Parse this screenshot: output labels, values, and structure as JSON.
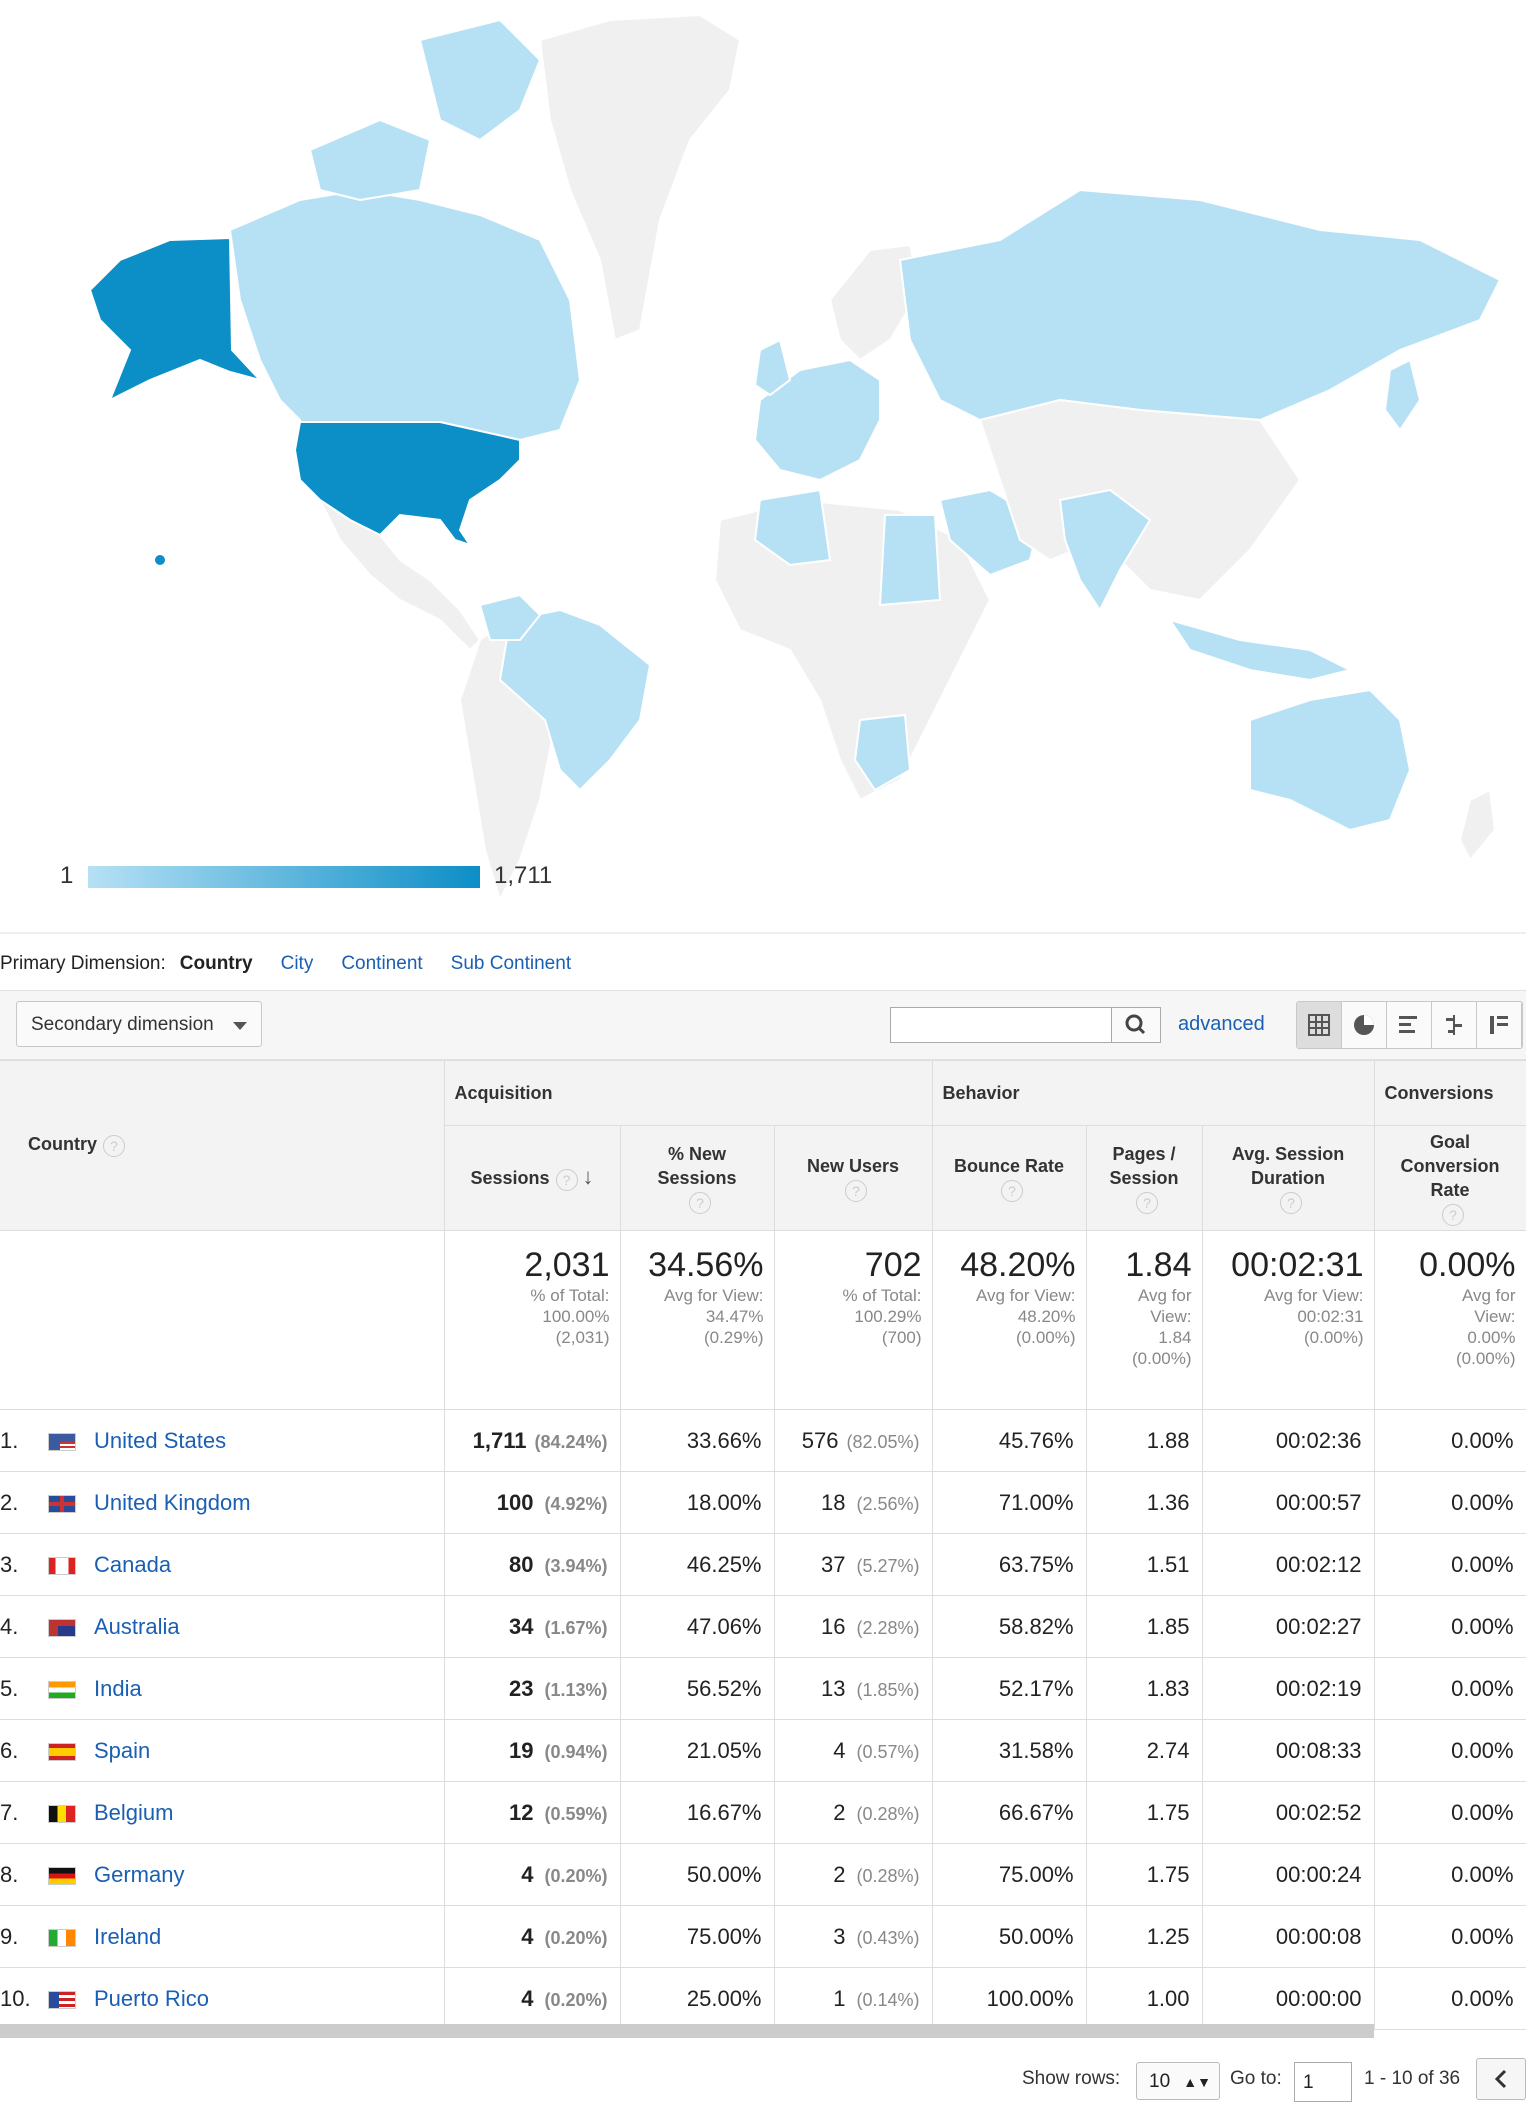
{
  "map": {
    "legend_min": "1",
    "legend_max": "1,711",
    "color_low": "#b6e1f5",
    "color_high": "#0c8ec6",
    "color_none": "#f0f0f0"
  },
  "primary_dimension": {
    "label": "Primary Dimension:",
    "current": "Country",
    "options": [
      "City",
      "Continent",
      "Sub Continent"
    ]
  },
  "toolbar": {
    "secondary_dimension": "Secondary dimension",
    "search_value": "",
    "advanced_label": "advanced"
  },
  "table": {
    "groups": {
      "acquisition": "Acquisition",
      "behavior": "Behavior",
      "conversions": "Conversions"
    },
    "columns": {
      "country": "Country",
      "sessions": "Sessions",
      "new_sessions": "% New Sessions",
      "new_users": "New Users",
      "bounce_rate": "Bounce Rate",
      "pages_session": "Pages / Session",
      "avg_duration": "Avg. Session Duration",
      "goal_rate": "Goal Conversion Rate"
    },
    "totals": {
      "sessions": {
        "value": "2,031",
        "sub1": "% of Total:",
        "sub2": "100.00%",
        "sub3": "(2,031)"
      },
      "new_sessions": {
        "value": "34.56%",
        "sub1": "Avg for View:",
        "sub2": "34.47%",
        "sub3": "(0.29%)"
      },
      "new_users": {
        "value": "702",
        "sub1": "% of Total:",
        "sub2": "100.29%",
        "sub3": "(700)"
      },
      "bounce_rate": {
        "value": "48.20%",
        "sub1": "Avg for View:",
        "sub2": "48.20%",
        "sub3": "(0.00%)"
      },
      "pages_session": {
        "value": "1.84",
        "sub1": "Avg for",
        "sub2": "View:",
        "sub3": "1.84",
        "sub4": "(0.00%)"
      },
      "avg_duration": {
        "value": "00:02:31",
        "sub1": "Avg for View:",
        "sub2": "00:02:31",
        "sub3": "(0.00%)"
      },
      "goal_rate": {
        "value": "0.00%",
        "sub1": "Avg for",
        "sub2": "View:",
        "sub3": "0.00%",
        "sub4": "(0.00%)"
      }
    },
    "rows": [
      {
        "n": "1.",
        "country": "United States",
        "flag": "us-flag",
        "sessions": "1,711",
        "sessions_pct": "(84.24%)",
        "new_sessions": "33.66%",
        "new_users": "576",
        "new_users_pct": "(82.05%)",
        "bounce": "45.76%",
        "pages": "1.88",
        "duration": "00:02:36",
        "goal": "0.00%"
      },
      {
        "n": "2.",
        "country": "United Kingdom",
        "flag": "uk-flag",
        "sessions": "100",
        "sessions_pct": "(4.92%)",
        "new_sessions": "18.00%",
        "new_users": "18",
        "new_users_pct": "(2.56%)",
        "bounce": "71.00%",
        "pages": "1.36",
        "duration": "00:00:57",
        "goal": "0.00%"
      },
      {
        "n": "3.",
        "country": "Canada",
        "flag": "canada-flag",
        "sessions": "80",
        "sessions_pct": "(3.94%)",
        "new_sessions": "46.25%",
        "new_users": "37",
        "new_users_pct": "(5.27%)",
        "bounce": "63.75%",
        "pages": "1.51",
        "duration": "00:02:12",
        "goal": "0.00%"
      },
      {
        "n": "4.",
        "country": "Australia",
        "flag": "australia-flag",
        "sessions": "34",
        "sessions_pct": "(1.67%)",
        "new_sessions": "47.06%",
        "new_users": "16",
        "new_users_pct": "(2.28%)",
        "bounce": "58.82%",
        "pages": "1.85",
        "duration": "00:02:27",
        "goal": "0.00%"
      },
      {
        "n": "5.",
        "country": "India",
        "flag": "india-flag",
        "sessions": "23",
        "sessions_pct": "(1.13%)",
        "new_sessions": "56.52%",
        "new_users": "13",
        "new_users_pct": "(1.85%)",
        "bounce": "52.17%",
        "pages": "1.83",
        "duration": "00:02:19",
        "goal": "0.00%"
      },
      {
        "n": "6.",
        "country": "Spain",
        "flag": "spain-flag",
        "sessions": "19",
        "sessions_pct": "(0.94%)",
        "new_sessions": "21.05%",
        "new_users": "4",
        "new_users_pct": "(0.57%)",
        "bounce": "31.58%",
        "pages": "2.74",
        "duration": "00:08:33",
        "goal": "0.00%"
      },
      {
        "n": "7.",
        "country": "Belgium",
        "flag": "belgium-flag",
        "sessions": "12",
        "sessions_pct": "(0.59%)",
        "new_sessions": "16.67%",
        "new_users": "2",
        "new_users_pct": "(0.28%)",
        "bounce": "66.67%",
        "pages": "1.75",
        "duration": "00:02:52",
        "goal": "0.00%"
      },
      {
        "n": "8.",
        "country": "Germany",
        "flag": "germany-flag",
        "sessions": "4",
        "sessions_pct": "(0.20%)",
        "new_sessions": "50.00%",
        "new_users": "2",
        "new_users_pct": "(0.28%)",
        "bounce": "75.00%",
        "pages": "1.75",
        "duration": "00:00:24",
        "goal": "0.00%"
      },
      {
        "n": "9.",
        "country": "Ireland",
        "flag": "ireland-flag",
        "sessions": "4",
        "sessions_pct": "(0.20%)",
        "new_sessions": "75.00%",
        "new_users": "3",
        "new_users_pct": "(0.43%)",
        "bounce": "50.00%",
        "pages": "1.25",
        "duration": "00:00:08",
        "goal": "0.00%"
      },
      {
        "n": "10.",
        "country": "Puerto Rico",
        "flag": "puerto-rico-flag",
        "sessions": "4",
        "sessions_pct": "(0.20%)",
        "new_sessions": "25.00%",
        "new_users": "1",
        "new_users_pct": "(0.14%)",
        "bounce": "100.00%",
        "pages": "1.00",
        "duration": "00:00:00",
        "goal": "0.00%"
      }
    ]
  },
  "footer": {
    "show_rows_label": "Show rows:",
    "show_rows_value": "10",
    "goto_label": "Go to:",
    "goto_value": "1",
    "range": "1 - 10 of 36"
  }
}
